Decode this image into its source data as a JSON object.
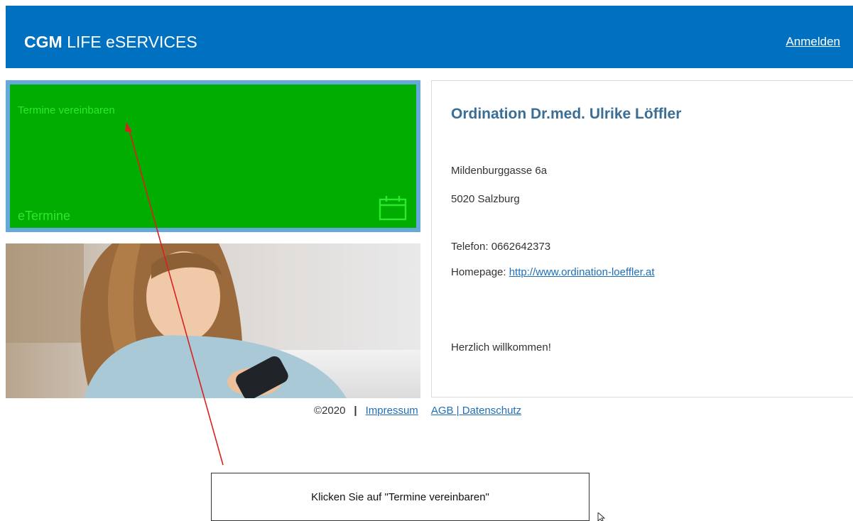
{
  "header": {
    "brand_bold": "CGM",
    "brand_rest": "LIFE eSERVICES",
    "login_label": "Anmelden"
  },
  "tile": {
    "link_label": "Termine vereinbaren",
    "title": "eTermine",
    "icon": "calendar-icon",
    "color": "#00ad00"
  },
  "photo": {
    "description": "woman-with-smartphone-photo"
  },
  "practice": {
    "name": "Ordination Dr.med. Ulrike Löffler",
    "street": "Mildenburggasse 6a",
    "city": "5020 Salzburg",
    "phone": "Telefon: 0662642373",
    "homepage_label": "Homepage: ",
    "homepage_url": "http://www.ordination-loeffler.at",
    "welcome": "Herzlich willkommen!"
  },
  "footer": {
    "copyright": "©2020",
    "separator": "|",
    "impressum": "Impressum",
    "agb": "AGB | Datenschutz"
  },
  "annotation": {
    "callout_text": "Klicken Sie auf \"Termine vereinbaren\"",
    "arrow_color": "#d9201e"
  }
}
